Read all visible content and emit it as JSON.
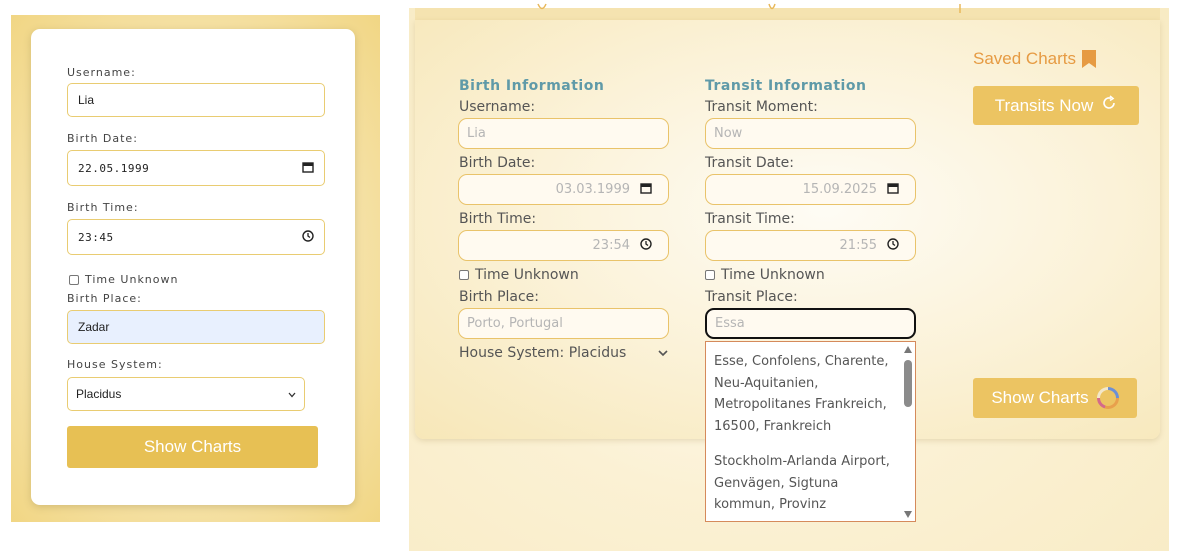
{
  "left": {
    "username_label": "Username:",
    "username_value": "Lia",
    "birth_date_label": "Birth Date:",
    "birth_date_value": "22.05.1999",
    "birth_time_label": "Birth Time:",
    "birth_time_value": "23:45",
    "time_unknown_label": "Time Unknown",
    "birth_place_label": "Birth Place:",
    "birth_place_value": "Zadar",
    "house_system_label": "House System:",
    "house_system_value": "Placidus",
    "show_charts_label": "Show Charts"
  },
  "right": {
    "birth_info_heading": "Birth Information",
    "transit_info_heading": "Transit Information",
    "birth": {
      "username_label": "Username:",
      "username_placeholder": "Lia",
      "birth_date_label": "Birth Date:",
      "birth_date_value": "03.03.1999",
      "birth_time_label": "Birth Time:",
      "birth_time_value": "23:54",
      "time_unknown_label": "Time Unknown",
      "birth_place_label": "Birth Place:",
      "birth_place_placeholder": "Porto, Portugal",
      "house_system_label": "House System: Placidus"
    },
    "transit": {
      "moment_label": "Transit Moment:",
      "moment_placeholder": "Now",
      "date_label": "Transit Date:",
      "date_value": "15.09.2025",
      "time_label": "Transit Time:",
      "time_value": "21:55",
      "time_unknown_label": "Time Unknown",
      "place_label": "Transit Place:",
      "place_value": "Essa"
    },
    "saved_charts_label": "Saved Charts",
    "transits_now_label": "Transits Now",
    "show_charts_label": "Show Charts",
    "dropdown_options": [
      "Esse, Confolens, Charente, Neu-Aquitanien, Metropolitanes Frankreich, 16500, Frankreich",
      "Stockholm-Arlanda Airport, Genvägen, Sigtuna kommun, Provinz"
    ]
  },
  "icons": {
    "calendar": "calendar-icon",
    "clock": "clock-icon",
    "bookmark": "bookmark-icon",
    "refresh": "refresh-icon",
    "spinner": "spinner-icon",
    "chevron": "chevron-down-icon"
  },
  "colors": {
    "accent_gold": "#e7c054",
    "heading_teal": "#5f9aa8",
    "saved_orange": "#e69b43"
  }
}
